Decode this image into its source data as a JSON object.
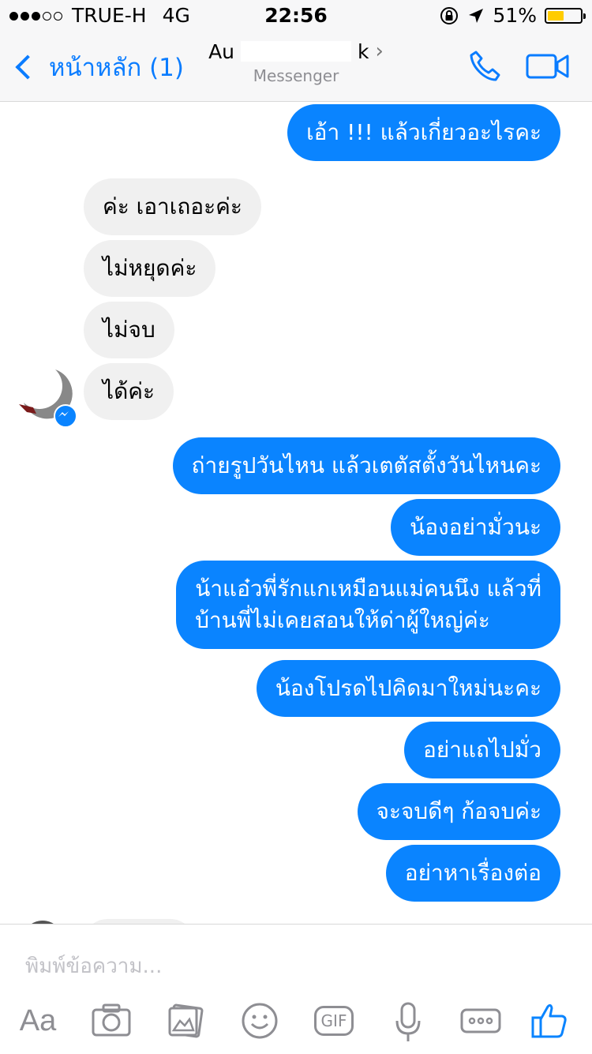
{
  "status_bar": {
    "carrier": "TRUE-H",
    "network": "4G",
    "time": "22:56",
    "battery_percent": "51%",
    "battery_level": 0.51,
    "signal_bars": 3
  },
  "nav": {
    "back_label": "หน้าหลัก (1)",
    "contact_name_visible": "Au",
    "contact_name_tail": "k",
    "subtitle": "Messenger",
    "accent_color": "#0a7cff"
  },
  "messages": [
    {
      "side": "out",
      "text": "เอ้า !!! แล้วเกี่ยวอะไรคะ"
    },
    {
      "side": "in",
      "text": "ค่ะ เอาเถอะค่ะ"
    },
    {
      "side": "in",
      "text": "ไม่หยุดค่ะ"
    },
    {
      "side": "in",
      "text": "ไม่จบ"
    },
    {
      "side": "in",
      "text": "ได้ค่ะ"
    },
    {
      "side": "out",
      "text": "ถ่ายรูปวันไหน แล้วเตตัสตั้งวันไหนคะ"
    },
    {
      "side": "out",
      "text": "น้องอย่ามั่วนะ"
    },
    {
      "side": "out",
      "line1": "น้าแอ๋วพี่รักแกเหมือนแม่คนนึง แล้วที่",
      "line2": "บ้านพี่ไม่เคยสอนให้ด่าผู้ใหญ่ค่ะ"
    },
    {
      "side": "out",
      "text": "น้องโปรดไปคิดมาใหม่นะคะ"
    },
    {
      "side": "out",
      "text": "อย่าแถไปมั่ว"
    },
    {
      "side": "out",
      "text": "จะจบดีๆ ก้อจบค่ะ"
    },
    {
      "side": "out",
      "text": "อย่าหาเรื่องต่อ"
    }
  ],
  "composer": {
    "placeholder": "พิมพ์ข้อความ...",
    "aa_label": "Aa",
    "gif_label": "GIF",
    "icons": [
      "text-format-icon",
      "camera-icon",
      "photo-gallery-icon",
      "emoji-icon",
      "gif-icon",
      "microphone-icon",
      "more-icon",
      "thumbs-up-icon"
    ]
  },
  "colors": {
    "outgoing_bubble": "#0a84ff",
    "incoming_bubble": "#f0f0f0",
    "bar_background": "#f7f7f8"
  }
}
